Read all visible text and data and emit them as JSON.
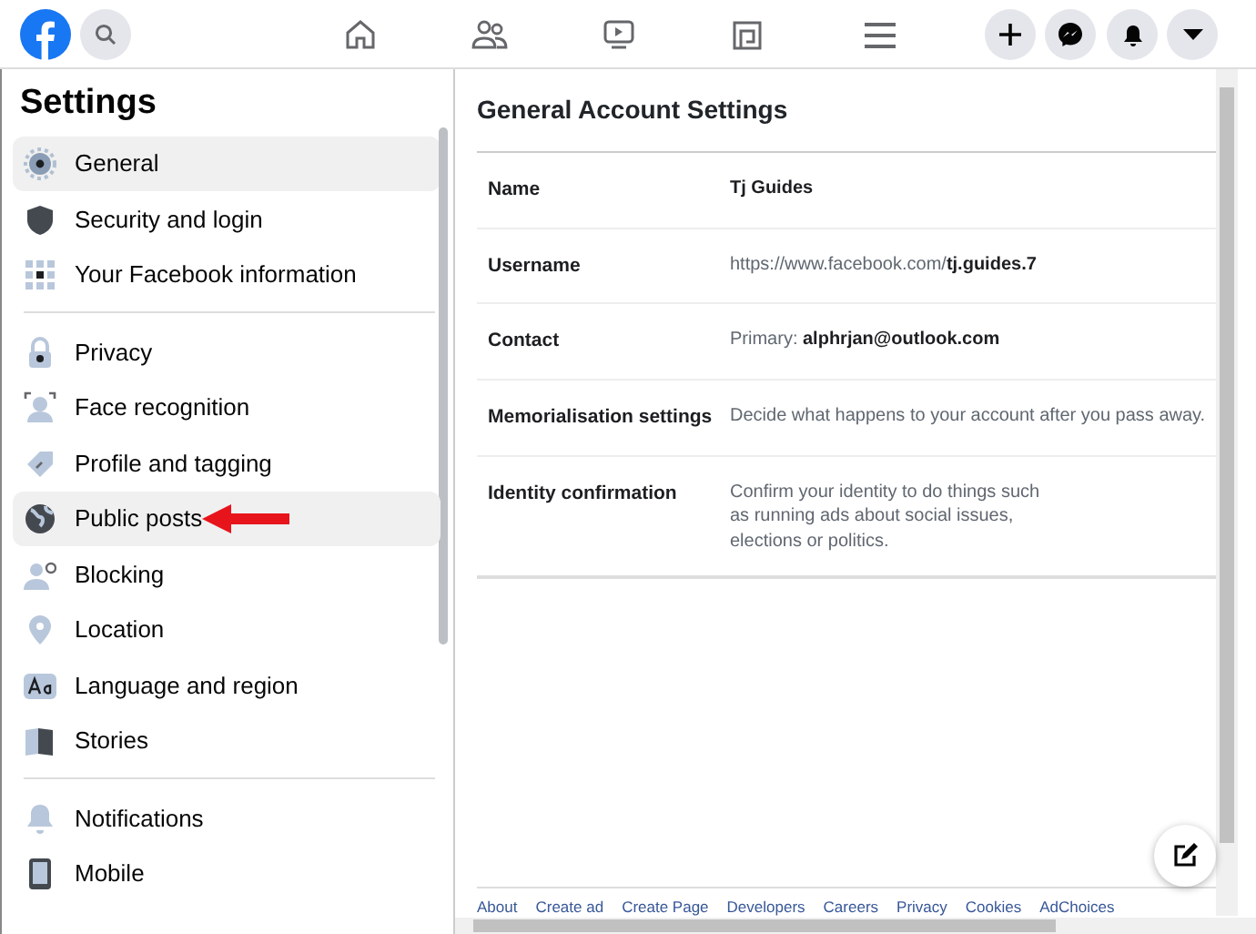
{
  "sidebar": {
    "title": "Settings",
    "groups": [
      {
        "items": [
          {
            "label": "General",
            "selected": true
          },
          {
            "label": "Security and login",
            "selected": false
          },
          {
            "label": "Your Facebook information",
            "selected": false
          }
        ]
      },
      {
        "items": [
          {
            "label": "Privacy",
            "selected": false
          },
          {
            "label": "Face recognition",
            "selected": false
          },
          {
            "label": "Profile and tagging",
            "selected": false
          },
          {
            "label": "Public posts",
            "selected": true
          },
          {
            "label": "Blocking",
            "selected": false
          },
          {
            "label": "Location",
            "selected": false
          },
          {
            "label": "Language and region",
            "selected": false
          },
          {
            "label": "Stories",
            "selected": false
          }
        ]
      },
      {
        "items": [
          {
            "label": "Notifications",
            "selected": false
          },
          {
            "label": "Mobile",
            "selected": false
          }
        ]
      }
    ]
  },
  "main": {
    "title": "General Account Settings",
    "rows": [
      {
        "label": "Name",
        "value": "**Tj Guides**"
      },
      {
        "label": "Username",
        "value": "https://www.facebook.com/**tj.guides.7**"
      },
      {
        "label": "Contact",
        "value": "Primary: **alphrjan@outlook.com**"
      },
      {
        "label": "Memorialisation settings",
        "value": "Decide what happens to your account after you pass away."
      },
      {
        "label": "Identity confirmation",
        "value": "Confirm your identity to do things such\nas running ads about social issues,\nelections or politics."
      }
    ]
  },
  "footer": {
    "links": [
      "About",
      "Create ad",
      "Create Page",
      "Developers",
      "Careers",
      "Privacy",
      "Cookies",
      "AdChoices"
    ]
  }
}
